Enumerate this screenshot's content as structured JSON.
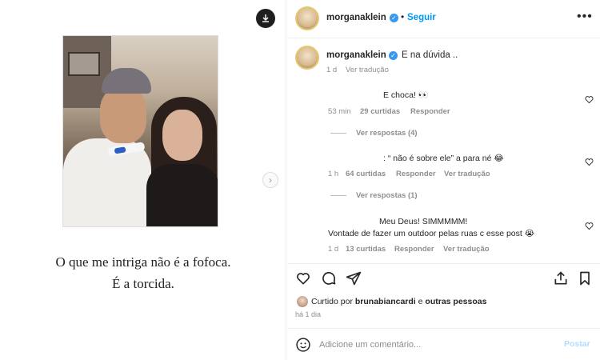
{
  "media": {
    "caption_line1": "O que me intriga não é a fofoca.",
    "caption_line2": "É a torcida.",
    "download_icon": "download-icon",
    "next_icon": "chevron-right-icon"
  },
  "header": {
    "username": "morganaklein",
    "follow_label": "Seguir",
    "separator": "•",
    "more_label": "•••"
  },
  "caption": {
    "username": "morganaklein",
    "text": "E na dúvida ..",
    "time": "1 d",
    "translate": "Ver tradução"
  },
  "comments": [
    {
      "text": "E choca! 👀",
      "time": "53 min",
      "likes": "29 curtidas",
      "reply": "Responder",
      "view_replies": "Ver respostas (4)"
    },
    {
      "text": ": “ não é sobre ele” a para né 😂",
      "time": "1 h",
      "likes": "64 curtidas",
      "reply": "Responder",
      "translate": "Ver tradução",
      "view_replies": "Ver respostas (1)"
    },
    {
      "text_line1": "Meu Deus! SIMMMMM!",
      "text_line2": "Vontade de fazer um outdoor pelas ruas c esse post 😭",
      "time": "1 d",
      "likes": "13 curtidas",
      "reply": "Responder",
      "translate": "Ver tradução"
    }
  ],
  "actions": {
    "like_icon": "heart-icon",
    "comment_icon": "comment-icon",
    "share_icon": "paper-plane-icon",
    "boost_icon": "share-out-icon",
    "save_icon": "bookmark-icon"
  },
  "likes": {
    "prefix": "Curtido por",
    "user": "brunabiancardi",
    "joiner": "e",
    "others": "outras pessoas"
  },
  "posted_ago": "há 1 dia",
  "composer": {
    "placeholder": "Adicione um comentário...",
    "post_label": "Postar"
  },
  "colors": {
    "link_blue": "#0095f6",
    "verified_blue": "#3897f0",
    "muted": "#8e8e8e"
  }
}
